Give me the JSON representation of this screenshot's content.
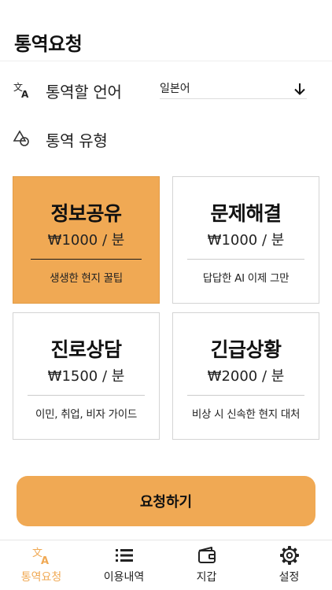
{
  "header": {
    "title": "통역요청"
  },
  "language_row": {
    "label": "통역할 언어",
    "value": "일본어",
    "icon": "translate-icon"
  },
  "type_row": {
    "label": "통역 유형",
    "icon": "shapes-icon"
  },
  "cards": [
    {
      "title": "정보공유",
      "price": "₩1000 / 분",
      "desc": "생생한 현지 꿀팁",
      "selected": true
    },
    {
      "title": "문제해결",
      "price": "₩1000 / 분",
      "desc": "답답한 AI 이제 그만",
      "selected": false
    },
    {
      "title": "진로상담",
      "price": "₩1500 / 분",
      "desc": "이민, 취업, 비자 가이드",
      "selected": false
    },
    {
      "title": "긴급상황",
      "price": "₩2000 / 분",
      "desc": "비상 시 신속한 현지 대처",
      "selected": false
    }
  ],
  "request_button": {
    "label": "요청하기"
  },
  "bottom_nav": {
    "items": [
      {
        "label": "통역요청",
        "icon": "translate-icon",
        "active": true
      },
      {
        "label": "이용내역",
        "icon": "list-icon",
        "active": false
      },
      {
        "label": "지갑",
        "icon": "wallet-icon",
        "active": false
      },
      {
        "label": "설정",
        "icon": "gear-icon",
        "active": false
      }
    ]
  },
  "colors": {
    "accent": "#f0a954",
    "text": "#111111",
    "border": "#d4d4d4"
  }
}
